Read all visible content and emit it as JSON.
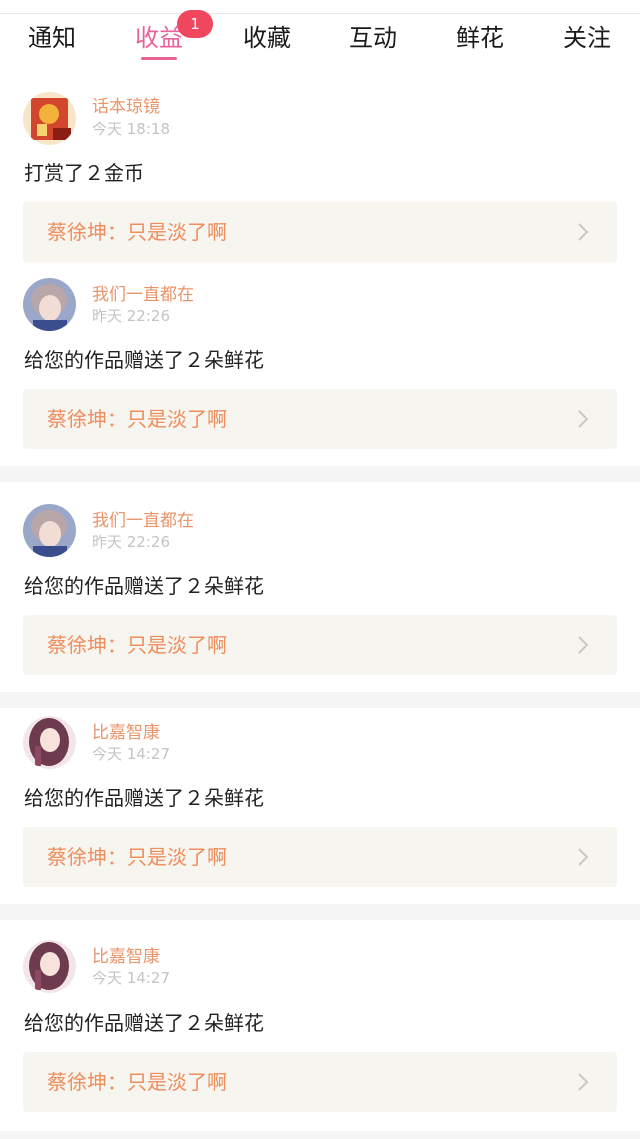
{
  "tabs": [
    {
      "label": "通知",
      "active": false
    },
    {
      "label": "收益",
      "active": true,
      "badge": "1"
    },
    {
      "label": "收藏",
      "active": false
    },
    {
      "label": "互动",
      "active": false
    },
    {
      "label": "鲜花",
      "active": false
    },
    {
      "label": "关注",
      "active": false
    }
  ],
  "colors": {
    "accent": "#e8629a",
    "badge": "#f0465e",
    "username": "#e8956a",
    "ref_text": "#ef8d5c",
    "ref_bg": "#f6f5ef"
  },
  "items": [
    {
      "user": "话本琼镜",
      "time": "今天 18:18",
      "message": "打赏了２金币",
      "ref": "蔡徐坤：只是淡了啊",
      "avatar": "book-avatar"
    },
    {
      "user": "我们一直都在",
      "time": "昨天 22:26",
      "message": "给您的作品赠送了２朵鲜花",
      "ref": "蔡徐坤：只是淡了啊",
      "avatar": "boy-avatar"
    },
    {
      "user": "我们一直都在",
      "time": "昨天 22:26",
      "message": "给您的作品赠送了２朵鲜花",
      "ref": "蔡徐坤：只是淡了啊",
      "avatar": "boy-avatar"
    },
    {
      "user": "比嘉智康",
      "time": "今天 14:27",
      "message": "给您的作品赠送了２朵鲜花",
      "ref": "蔡徐坤：只是淡了啊",
      "avatar": "anime-girl-avatar"
    },
    {
      "user": "比嘉智康",
      "time": "今天 14:27",
      "message": "给您的作品赠送了２朵鲜花",
      "ref": "蔡徐坤：只是淡了啊",
      "avatar": "anime-girl-avatar"
    }
  ]
}
